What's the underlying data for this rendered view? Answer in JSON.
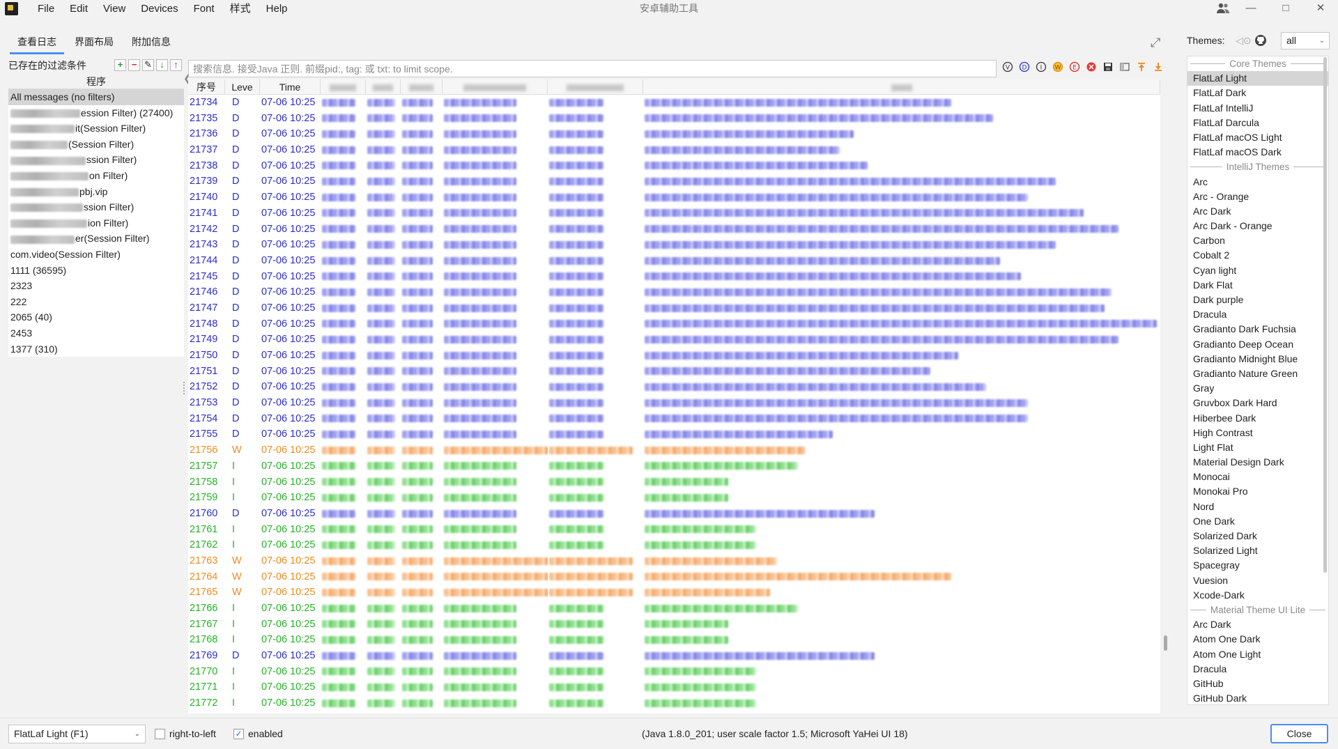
{
  "window": {
    "title": "安卓辅助工具"
  },
  "menu": [
    "File",
    "Edit",
    "View",
    "Devices",
    "Font",
    "样式",
    "Help"
  ],
  "tabs": [
    {
      "label": "查看日志",
      "active": true
    },
    {
      "label": "界面布局",
      "active": false
    },
    {
      "label": "附加信息",
      "active": false
    }
  ],
  "filters": {
    "title": "已存在的过滤条件",
    "column_header": "程序",
    "items": [
      {
        "text": "All messages (no filters)",
        "blur": 0,
        "selected": true
      },
      {
        "text": "ession Filter) (27400)",
        "blur": 100
      },
      {
        "text": "it(Session Filter)",
        "blur": 92
      },
      {
        "text": "(Session Filter)",
        "blur": 82
      },
      {
        "text": "ssion Filter)",
        "blur": 108
      },
      {
        "text": "on Filter)",
        "blur": 112
      },
      {
        "text": "pbj.vip",
        "blur": 98
      },
      {
        "text": "ssion Filter)",
        "blur": 104
      },
      {
        "text": "ion Filter)",
        "blur": 110
      },
      {
        "text": "er(Session Filter)",
        "blur": 92
      },
      {
        "text": "com.video(Session Filter)",
        "blur": 0
      },
      {
        "text": "1111 (36595)",
        "blur": 0
      },
      {
        "text": "2323",
        "blur": 0
      },
      {
        "text": "222",
        "blur": 0
      },
      {
        "text": "2065 (40)",
        "blur": 0
      },
      {
        "text": "2453",
        "blur": 0
      },
      {
        "text": "1377 (310)",
        "blur": 0
      }
    ]
  },
  "search": {
    "placeholder": "搜索信息. 接受Java 正则. 前缀pid:, tag: 或 txt: to limit scope."
  },
  "log": {
    "headers": [
      "序号",
      "Leve",
      "Time"
    ],
    "rows": [
      {
        "seq": "21734",
        "lvl": "D",
        "time": "07-06 10:25",
        "m": 440
      },
      {
        "seq": "21735",
        "lvl": "D",
        "time": "07-06 10:25",
        "m": 500
      },
      {
        "seq": "21736",
        "lvl": "D",
        "time": "07-06 10:25",
        "m": 300
      },
      {
        "seq": "21737",
        "lvl": "D",
        "time": "07-06 10:25",
        "m": 280
      },
      {
        "seq": "21738",
        "lvl": "D",
        "time": "07-06 10:25",
        "m": 320
      },
      {
        "seq": "21739",
        "lvl": "D",
        "time": "07-06 10:25",
        "m": 590
      },
      {
        "seq": "21740",
        "lvl": "D",
        "time": "07-06 10:25",
        "m": 550
      },
      {
        "seq": "21741",
        "lvl": "D",
        "time": "07-06 10:25",
        "m": 630
      },
      {
        "seq": "21742",
        "lvl": "D",
        "time": "07-06 10:25",
        "m": 680
      },
      {
        "seq": "21743",
        "lvl": "D",
        "time": "07-06 10:25",
        "m": 590
      },
      {
        "seq": "21744",
        "lvl": "D",
        "time": "07-06 10:25",
        "m": 510
      },
      {
        "seq": "21745",
        "lvl": "D",
        "time": "07-06 10:25",
        "m": 540
      },
      {
        "seq": "21746",
        "lvl": "D",
        "time": "07-06 10:25",
        "m": 670
      },
      {
        "seq": "21747",
        "lvl": "D",
        "time": "07-06 10:25",
        "m": 660
      },
      {
        "seq": "21748",
        "lvl": "D",
        "time": "07-06 10:25",
        "m": 735
      },
      {
        "seq": "21749",
        "lvl": "D",
        "time": "07-06 10:25",
        "m": 680
      },
      {
        "seq": "21750",
        "lvl": "D",
        "time": "07-06 10:25",
        "m": 450
      },
      {
        "seq": "21751",
        "lvl": "D",
        "time": "07-06 10:25",
        "m": 410
      },
      {
        "seq": "21752",
        "lvl": "D",
        "time": "07-06 10:25",
        "m": 490
      },
      {
        "seq": "21753",
        "lvl": "D",
        "time": "07-06 10:25",
        "m": 550
      },
      {
        "seq": "21754",
        "lvl": "D",
        "time": "07-06 10:25",
        "m": 550
      },
      {
        "seq": "21755",
        "lvl": "D",
        "time": "07-06 10:25",
        "m": 270
      },
      {
        "seq": "21756",
        "lvl": "W",
        "time": "07-06 10:25",
        "m": 230
      },
      {
        "seq": "21757",
        "lvl": "I",
        "time": "07-06 10:25",
        "m": 220
      },
      {
        "seq": "21758",
        "lvl": "I",
        "time": "07-06 10:25",
        "m": 120
      },
      {
        "seq": "21759",
        "lvl": "I",
        "time": "07-06 10:25",
        "m": 120
      },
      {
        "seq": "21760",
        "lvl": "D",
        "time": "07-06 10:25",
        "m": 330
      },
      {
        "seq": "21761",
        "lvl": "I",
        "time": "07-06 10:25",
        "m": 160
      },
      {
        "seq": "21762",
        "lvl": "I",
        "time": "07-06 10:25",
        "m": 160
      },
      {
        "seq": "21763",
        "lvl": "W",
        "time": "07-06 10:25",
        "m": 190
      },
      {
        "seq": "21764",
        "lvl": "W",
        "time": "07-06 10:25",
        "m": 440
      },
      {
        "seq": "21765",
        "lvl": "W",
        "time": "07-06 10:25",
        "m": 180
      },
      {
        "seq": "21766",
        "lvl": "I",
        "time": "07-06 10:25",
        "m": 220
      },
      {
        "seq": "21767",
        "lvl": "I",
        "time": "07-06 10:25",
        "m": 120
      },
      {
        "seq": "21768",
        "lvl": "I",
        "time": "07-06 10:25",
        "m": 120
      },
      {
        "seq": "21769",
        "lvl": "D",
        "time": "07-06 10:25",
        "m": 330
      },
      {
        "seq": "21770",
        "lvl": "I",
        "time": "07-06 10:25",
        "m": 160
      },
      {
        "seq": "21771",
        "lvl": "I",
        "time": "07-06 10:25",
        "m": 160
      },
      {
        "seq": "21772",
        "lvl": "I",
        "time": "07-06 10:25",
        "m": 160
      }
    ]
  },
  "themes": {
    "label": "Themes:",
    "filter_value": "all",
    "items": [
      {
        "group": "Core Themes"
      },
      {
        "name": "FlatLaf Light",
        "selected": true
      },
      {
        "name": "FlatLaf Dark"
      },
      {
        "name": "FlatLaf IntelliJ"
      },
      {
        "name": "FlatLaf Darcula"
      },
      {
        "name": "FlatLaf macOS Light"
      },
      {
        "name": "FlatLaf macOS Dark"
      },
      {
        "group": "IntelliJ Themes"
      },
      {
        "name": "Arc"
      },
      {
        "name": "Arc - Orange"
      },
      {
        "name": "Arc Dark"
      },
      {
        "name": "Arc Dark - Orange"
      },
      {
        "name": "Carbon"
      },
      {
        "name": "Cobalt 2"
      },
      {
        "name": "Cyan light"
      },
      {
        "name": "Dark Flat"
      },
      {
        "name": "Dark purple"
      },
      {
        "name": "Dracula"
      },
      {
        "name": "Gradianto Dark Fuchsia"
      },
      {
        "name": "Gradianto Deep Ocean"
      },
      {
        "name": "Gradianto Midnight Blue"
      },
      {
        "name": "Gradianto Nature Green"
      },
      {
        "name": "Gray"
      },
      {
        "name": "Gruvbox Dark Hard"
      },
      {
        "name": "Hiberbee Dark"
      },
      {
        "name": "High Contrast"
      },
      {
        "name": "Light Flat"
      },
      {
        "name": "Material Design Dark"
      },
      {
        "name": "Monocai"
      },
      {
        "name": "Monokai Pro"
      },
      {
        "name": "Nord"
      },
      {
        "name": "One Dark"
      },
      {
        "name": "Solarized Dark"
      },
      {
        "name": "Solarized Light"
      },
      {
        "name": "Spacegray"
      },
      {
        "name": "Vuesion"
      },
      {
        "name": "Xcode-Dark"
      },
      {
        "group": "Material Theme UI Lite"
      },
      {
        "name": "Arc Dark"
      },
      {
        "name": "Atom One Dark"
      },
      {
        "name": "Atom One Light"
      },
      {
        "name": "Dracula"
      },
      {
        "name": "GitHub"
      },
      {
        "name": "GitHub Dark"
      }
    ]
  },
  "bottom": {
    "theme_combo": "FlatLaf Light (F1)",
    "rtl_label": "right-to-left",
    "rtl_checked": false,
    "enabled_label": "enabled",
    "enabled_checked": true,
    "info": "(Java 1.8.0_201;  user scale factor 1.5; Microsoft YaHei UI 18)",
    "close_label": "Close"
  },
  "colors": {
    "debug": "#2b2bd2",
    "warn": "#f08a1c",
    "info": "#22b422",
    "accent": "#4a8ef0"
  }
}
